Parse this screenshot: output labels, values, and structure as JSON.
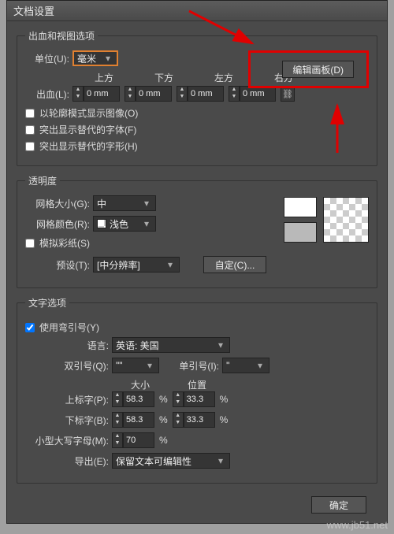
{
  "title": "文档设置",
  "bleed": {
    "legend": "出血和视图选项",
    "unit_label": "单位(U):",
    "unit_value": "毫米",
    "edit_artboard": "编辑画板(D)",
    "bleed_label": "出血(L):",
    "top": "上方",
    "bottom": "下方",
    "left": "左方",
    "right": "右方",
    "val": "0 mm",
    "chk_outline": "以轮廓模式显示图像(O)",
    "chk_highlight_font": "突出显示替代的字体(F)",
    "chk_highlight_glyph": "突出显示替代的字形(H)"
  },
  "transparency": {
    "legend": "透明度",
    "grid_size_label": "网格大小(G):",
    "grid_size_value": "中",
    "grid_color_label": "网格颜色(R):",
    "grid_color_value": "浅色",
    "simulate_paper": "模拟彩纸(S)",
    "preset_label": "预设(T):",
    "preset_value": "[中分辨率]",
    "custom_btn": "自定(C)..."
  },
  "text": {
    "legend": "文字选项",
    "use_curly_quotes": "使用弯引号(Y)",
    "language_label": "语言:",
    "language_value": "英语: 美国",
    "double_quote_label": "双引号(Q):",
    "double_quote_value": "\"\"",
    "single_quote_label": "单引号(I):",
    "single_quote_value": "''",
    "size_header": "大小",
    "position_header": "位置",
    "superscript_label": "上标字(P):",
    "subscript_label": "下标字(B):",
    "smallcaps_label": "小型大写字母(M):",
    "val_583": "58.3",
    "val_333": "33.3",
    "val_70": "70",
    "percent": "%",
    "export_label": "导出(E):",
    "export_value": "保留文本可编辑性"
  },
  "footer": {
    "ok": "确定"
  },
  "watermark": "www.jb51.net"
}
